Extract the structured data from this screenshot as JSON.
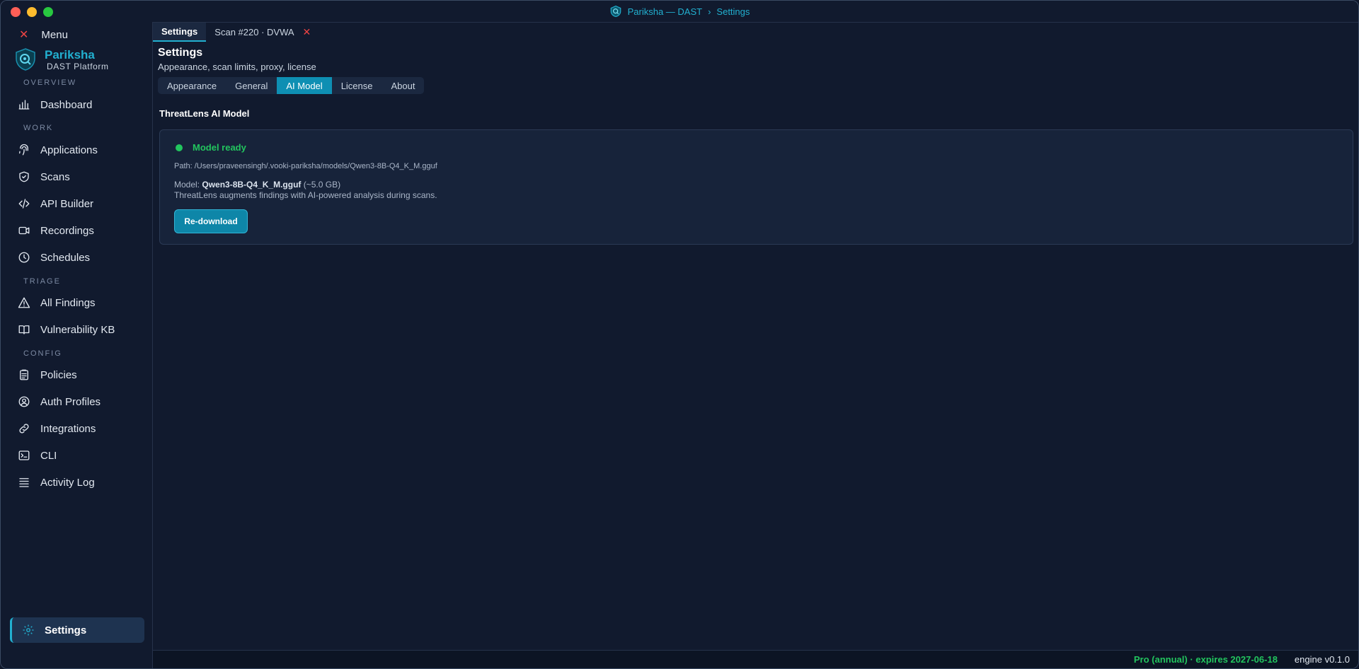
{
  "window": {
    "title_app": "Pariksha — DAST",
    "title_separator": "›",
    "title_page": "Settings"
  },
  "sidebar": {
    "menu_label": "Menu",
    "brand_name": "Pariksha",
    "brand_subtitle": "DAST Platform",
    "sections": {
      "overview": "OVERVIEW",
      "work": "WORK",
      "triage": "TRIAGE",
      "config": "CONFIG"
    },
    "items": {
      "dashboard": "Dashboard",
      "applications": "Applications",
      "scans": "Scans",
      "api_builder": "API Builder",
      "recordings": "Recordings",
      "schedules": "Schedules",
      "all_findings": "All Findings",
      "vulnerability_kb": "Vulnerability KB",
      "policies": "Policies",
      "auth_profiles": "Auth Profiles",
      "integrations": "Integrations",
      "cli": "CLI",
      "activity_log": "Activity Log",
      "settings": "Settings"
    }
  },
  "tabs": [
    {
      "label": "Settings",
      "active": true
    },
    {
      "label": "Scan #220 · DVWA",
      "active": false
    }
  ],
  "page": {
    "title": "Settings",
    "subtitle": "Appearance, scan limits, proxy, license"
  },
  "subtabs": [
    {
      "label": "Appearance"
    },
    {
      "label": "General"
    },
    {
      "label": "AI Model"
    },
    {
      "label": "License"
    },
    {
      "label": "About"
    }
  ],
  "ai_model": {
    "heading": "ThreatLens AI Model",
    "status": "Model ready",
    "path_label": "Path:",
    "path": "/Users/praveensingh/.vooki-pariksha/models/Qwen3-8B-Q4_K_M.gguf",
    "model_label": "Model:",
    "model_name": "Qwen3-8B-Q4_K_M.gguf",
    "model_size": "(~5.0 GB)",
    "description": "ThreatLens augments findings with AI-powered analysis during scans.",
    "button_label": "Re-download"
  },
  "statusbar": {
    "license": "Pro (annual) · expires 2027-06-18",
    "engine": "engine v0.1.0"
  },
  "colors": {
    "accent": "#22b0d0",
    "success": "#22c55e",
    "danger": "#ef4444"
  }
}
